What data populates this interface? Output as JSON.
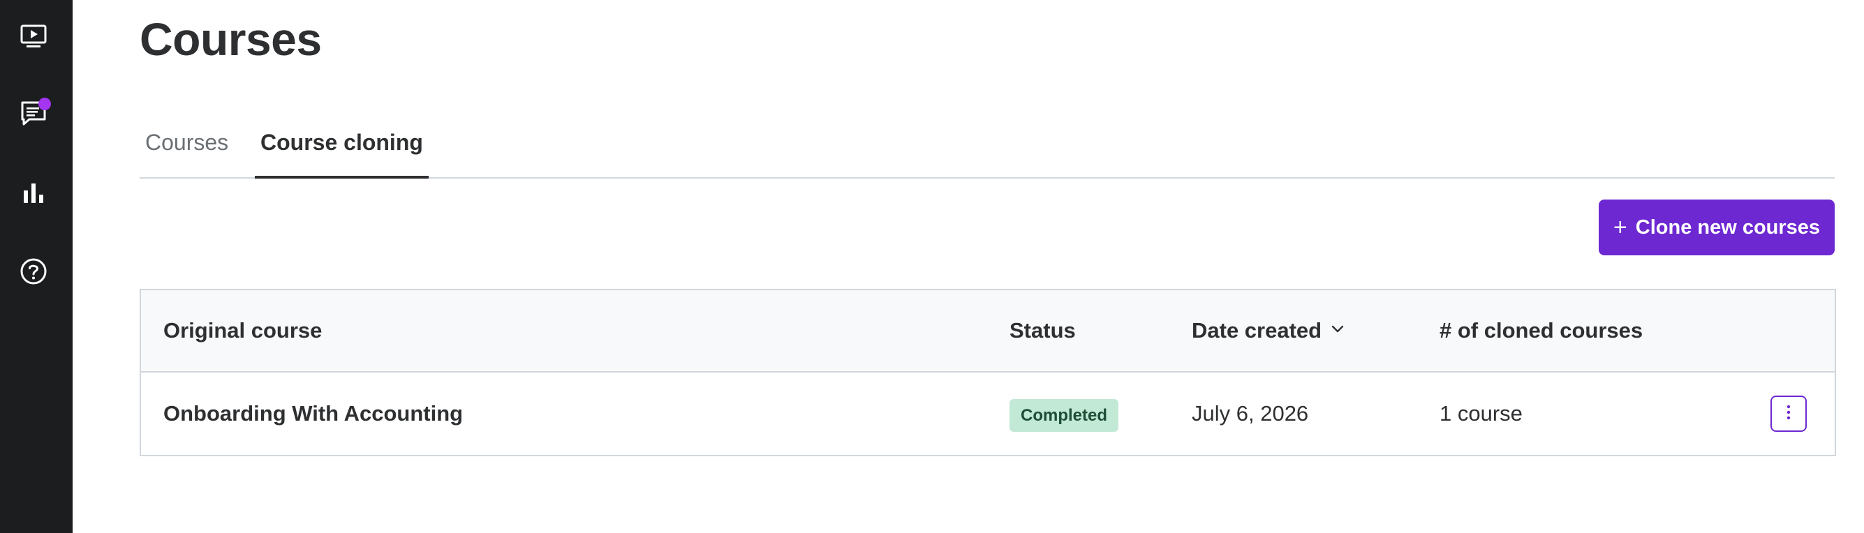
{
  "sidebar": {
    "icons": [
      "video-player-icon",
      "messages-icon",
      "bar-chart-icon",
      "help-icon"
    ],
    "notification_color": "#a435f0"
  },
  "page": {
    "title": "Courses"
  },
  "tabs": [
    {
      "label": "Courses",
      "active": false
    },
    {
      "label": "Course cloning",
      "active": true
    }
  ],
  "actions": {
    "clone_button_icon": "+",
    "clone_button_label": "Clone new courses",
    "accent_color": "#6d28d2"
  },
  "table": {
    "columns": [
      "Original course",
      "Status",
      "Date created",
      "# of cloned courses"
    ],
    "sorted_column": "Date created",
    "sort_icon": "chevron-down-icon",
    "rows": [
      {
        "original_course": "Onboarding With Accounting",
        "status": "Completed",
        "date_created": "July 6, 2026",
        "cloned_courses": "1 course",
        "menu_icon": "more-vertical-icon"
      }
    ]
  }
}
